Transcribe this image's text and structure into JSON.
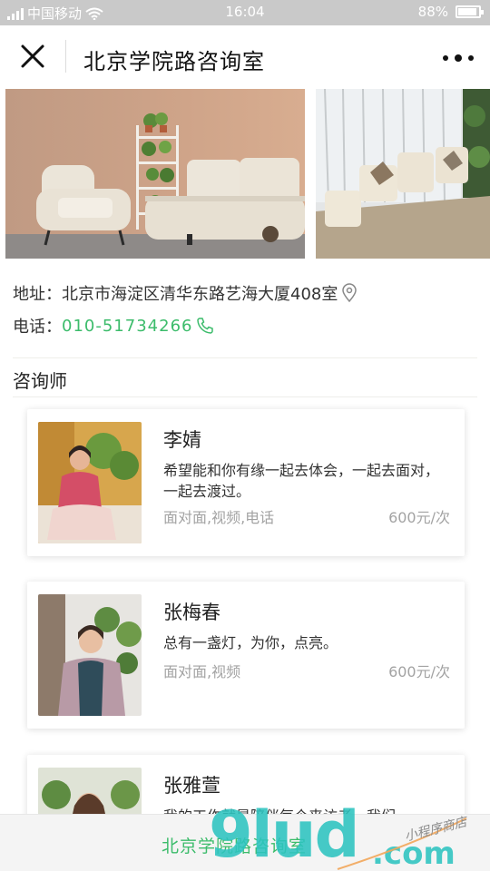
{
  "status_bar": {
    "carrier": "中国移动",
    "time": "16:04",
    "battery": "88%",
    "battery_level": 0.88
  },
  "nav": {
    "title": "北京学院路咨询室"
  },
  "info": {
    "address_label": "地址：",
    "address": "北京市海淀区清华东路艺海大厦408室",
    "phone_label": "电话：",
    "phone": "010-51734266"
  },
  "section_title": "咨询师",
  "counselors": [
    {
      "name": "李婧",
      "motto": "希望能和你有缘一起去体会，一起去面对，一起去渡过。",
      "modes": "面对面,视频,电话",
      "price": "600元/次"
    },
    {
      "name": "张梅春",
      "motto": "总有一盏灯，为你，点亮。",
      "modes": "面对面,视频",
      "price": "600元/次"
    },
    {
      "name": "张雅萱",
      "motto": "我的工作就是陪伴每个来访者，我们"
    }
  ],
  "bottom_bar": {
    "store_name": "北京学院路咨询室"
  },
  "watermark": {
    "logo_text": "9lud.com",
    "slogan": "小程序商店"
  },
  "colors": {
    "accent_green": "#3cbc6b",
    "status_bar_bg": "#c9c9c9",
    "watermark_teal": "#2dc4c0"
  }
}
